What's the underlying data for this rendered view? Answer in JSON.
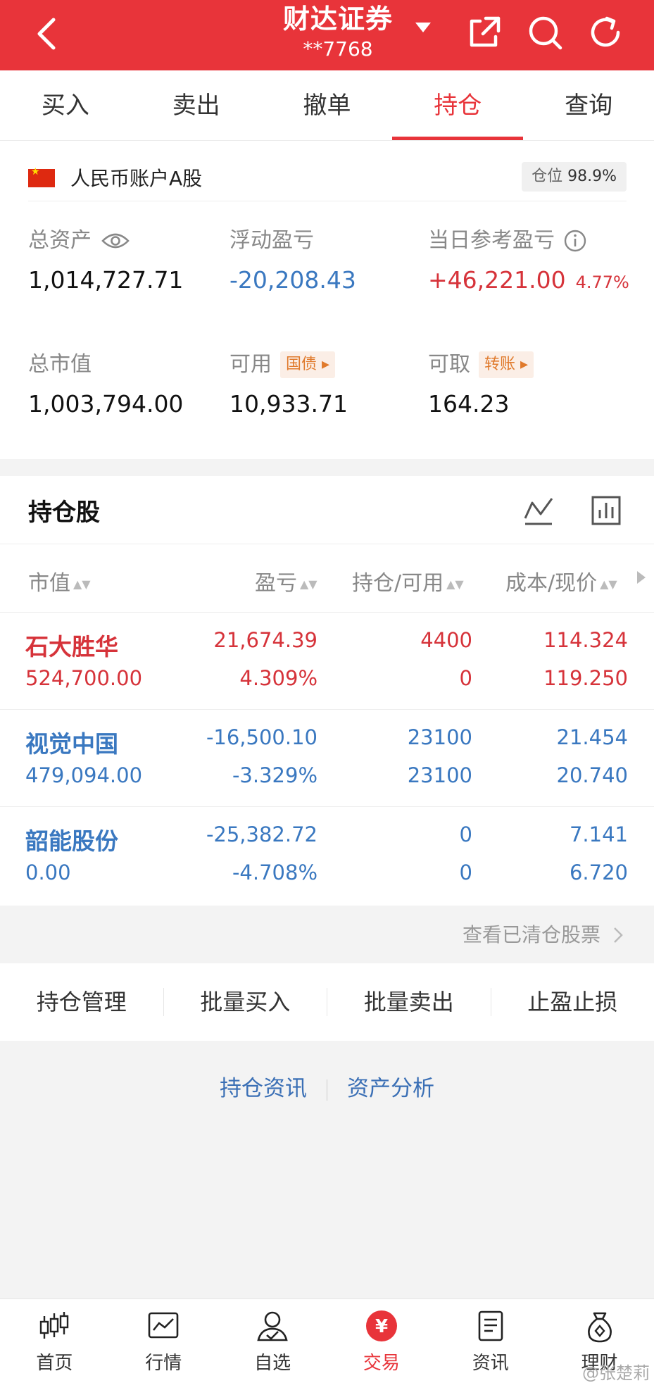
{
  "header": {
    "title": "财达证券",
    "account_masked": "**7768",
    "color": "#e8343a"
  },
  "tabs": [
    {
      "label": "买入"
    },
    {
      "label": "卖出"
    },
    {
      "label": "撤单"
    },
    {
      "label": "持仓",
      "active": true
    },
    {
      "label": "查询"
    }
  ],
  "account": {
    "name": "人民币账户A股",
    "position_label": "仓位",
    "position_value": "98.9%",
    "total_assets_label": "总资产",
    "total_assets": "1,014,727.71",
    "floating_pl_label": "浮动盈亏",
    "floating_pl": "-20,208.43",
    "daily_pl_label": "当日参考盈亏",
    "daily_pl": "+46,221.00",
    "daily_pl_pct": "4.77%",
    "market_value_label": "总市值",
    "market_value": "1,003,794.00",
    "available_label": "可用",
    "available_tag": "国债",
    "available": "10,933.71",
    "withdrawable_label": "可取",
    "withdrawable_tag": "转账",
    "withdrawable": "164.23"
  },
  "holdings": {
    "title": "持仓股",
    "columns": [
      "市值",
      "盈亏",
      "持仓/可用",
      "成本/现价"
    ],
    "rows": [
      {
        "name": "石大胜华",
        "market_value": "524,700.00",
        "pl": "21,674.39",
        "pl_pct": "4.309%",
        "holding": "4400",
        "available": "0",
        "cost": "114.324",
        "price": "119.250",
        "tone": "red"
      },
      {
        "name": "视觉中国",
        "market_value": "479,094.00",
        "pl": "-16,500.10",
        "pl_pct": "-3.329%",
        "holding": "23100",
        "available": "23100",
        "cost": "21.454",
        "price": "20.740",
        "tone": "blue"
      },
      {
        "name": "韶能股份",
        "market_value": "0.00",
        "pl": "-25,382.72",
        "pl_pct": "-4.708%",
        "holding": "0",
        "available": "0",
        "cost": "7.141",
        "price": "6.720",
        "tone": "blue"
      }
    ],
    "cleared_link": "查看已清仓股票"
  },
  "actions": [
    "持仓管理",
    "批量买入",
    "批量卖出",
    "止盈止损"
  ],
  "links": [
    "持仓资讯",
    "资产分析"
  ],
  "bottom_nav": [
    {
      "label": "首页",
      "icon": "candlestick-icon"
    },
    {
      "label": "行情",
      "icon": "market-chart-icon"
    },
    {
      "label": "自选",
      "icon": "user-check-icon"
    },
    {
      "label": "交易",
      "icon": "yuan-icon",
      "active": true
    },
    {
      "label": "资讯",
      "icon": "document-icon"
    },
    {
      "label": "理财",
      "icon": "money-bag-icon"
    }
  ],
  "watermark": "@张楚莉"
}
